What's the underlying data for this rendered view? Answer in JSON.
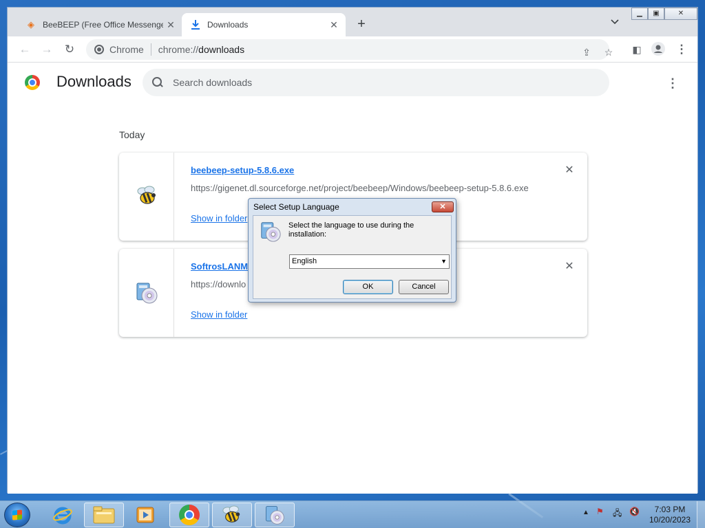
{
  "browser": {
    "tabs": [
      {
        "title": "BeeBEEP (Free Office Messenger)",
        "active": false
      },
      {
        "title": "Downloads",
        "active": true
      }
    ],
    "omnibox": {
      "site_label": "Chrome",
      "url_dim": "chrome://",
      "url_main": "downloads"
    }
  },
  "downloads_page": {
    "title": "Downloads",
    "search_placeholder": "Search downloads",
    "date_heading": "Today",
    "items": [
      {
        "filename": "beebeep-setup-5.8.6.exe",
        "url": "https://gigenet.dl.sourceforge.net/project/beebeep/Windows/beebeep-setup-5.8.6.exe",
        "action": "Show in folder"
      },
      {
        "filename": "SoftrosLANMe",
        "url": "https://downlo",
        "action": "Show in folder"
      }
    ]
  },
  "dialog": {
    "title": "Select Setup Language",
    "message": "Select the language to use during the installation:",
    "selected_language": "English",
    "ok_label": "OK",
    "cancel_label": "Cancel"
  },
  "taskbar": {
    "time": "7:03 PM",
    "date": "10/20/2023"
  },
  "colors": {
    "link": "#1a73e8",
    "accent": "#1a73e8",
    "dialog_close": "#c74a37"
  }
}
